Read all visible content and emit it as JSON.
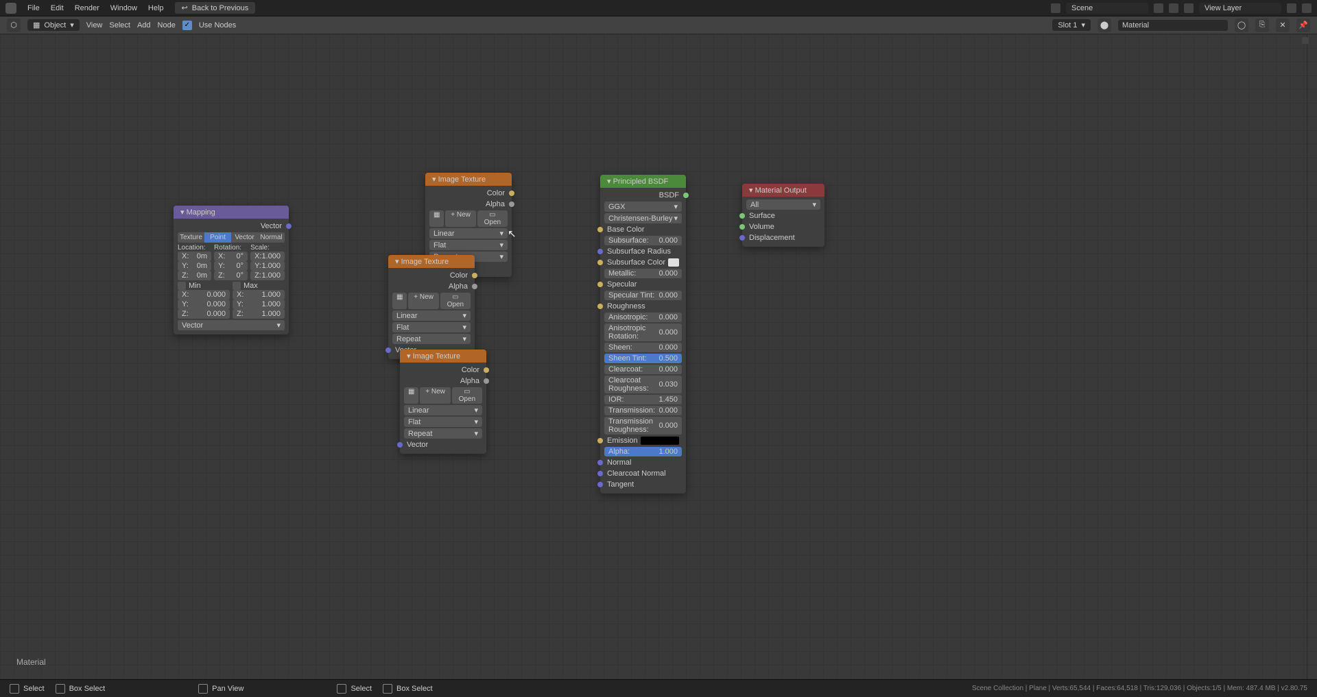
{
  "menu": {
    "file": "File",
    "edit": "Edit",
    "render": "Render",
    "window": "Window",
    "help": "Help",
    "back": "Back to Previous"
  },
  "top_right": {
    "scene": "Scene",
    "view_layer": "View Layer"
  },
  "header": {
    "mode": "Object",
    "view": "View",
    "select": "Select",
    "add": "Add",
    "node": "Node",
    "use_nodes": "Use Nodes",
    "slot": "Slot 1",
    "material": "Material"
  },
  "mat_label": "Material",
  "mapping": {
    "title": "Mapping",
    "out": "Vector",
    "tabs": [
      "Texture",
      "Point",
      "Vector",
      "Normal"
    ],
    "lbl_loc": "Location:",
    "lbl_rot": "Rotation:",
    "lbl_scale": "Scale:",
    "loc": [
      "0m",
      "0m",
      "0m"
    ],
    "rot": [
      "0°",
      "0°",
      "0°"
    ],
    "scale": [
      "1.000",
      "1.000",
      "1.000"
    ],
    "axes": [
      "X:",
      "Y:",
      "Z:"
    ],
    "min": "Min",
    "max": "Max",
    "minv": [
      "0.000",
      "0.000",
      "0.000"
    ],
    "maxv": [
      "1.000",
      "1.000",
      "1.000"
    ],
    "vec_in": "Vector"
  },
  "imgtex": {
    "title": "Image Texture",
    "color": "Color",
    "alpha": "Alpha",
    "new": "New",
    "open": "Open",
    "interp": "Linear",
    "proj": "Flat",
    "ext": "Repeat",
    "vec": "Vector"
  },
  "bsdf": {
    "title": "Principled BSDF",
    "out": "BSDF",
    "dist": "GGX",
    "sss_method": "Christensen-Burley",
    "inputs": [
      {
        "n": "Base Color",
        "t": "sock"
      },
      {
        "n": "Subsurface:",
        "v": "0.000",
        "t": "num"
      },
      {
        "n": "Subsurface Radius",
        "t": "sock"
      },
      {
        "n": "Subsurface Color",
        "t": "color",
        "c": "#e0e0e0"
      },
      {
        "n": "Metallic:",
        "v": "0.000",
        "t": "num"
      },
      {
        "n": "Specular",
        "t": "sock"
      },
      {
        "n": "Specular Tint:",
        "v": "0.000",
        "t": "num"
      },
      {
        "n": "Roughness",
        "t": "sock"
      },
      {
        "n": "Anisotropic:",
        "v": "0.000",
        "t": "num"
      },
      {
        "n": "Anisotropic Rotation:",
        "v": "0.000",
        "t": "num"
      },
      {
        "n": "Sheen:",
        "v": "0.000",
        "t": "num"
      },
      {
        "n": "Sheen Tint:",
        "v": "0.500",
        "t": "num",
        "hl": true
      },
      {
        "n": "Clearcoat:",
        "v": "0.000",
        "t": "num"
      },
      {
        "n": "Clearcoat Roughness:",
        "v": "0.030",
        "t": "num"
      },
      {
        "n": "IOR:",
        "v": "1.450",
        "t": "num"
      },
      {
        "n": "Transmission:",
        "v": "0.000",
        "t": "num"
      },
      {
        "n": "Transmission Roughness:",
        "v": "0.000",
        "t": "num"
      },
      {
        "n": "Emission",
        "t": "color",
        "c": "#000"
      },
      {
        "n": "Alpha:",
        "v": "1.000",
        "t": "num",
        "hl": true
      },
      {
        "n": "Normal",
        "t": "sock"
      },
      {
        "n": "Clearcoat Normal",
        "t": "sock"
      },
      {
        "n": "Tangent",
        "t": "sock"
      }
    ]
  },
  "output": {
    "title": "Material Output",
    "target": "All",
    "surface": "Surface",
    "volume": "Volume",
    "disp": "Displacement"
  },
  "status": {
    "select": "Select",
    "box": "Box Select",
    "pan": "Pan View",
    "info": "Scene Collection | Plane | Verts:65,544 | Faces:64,518 | Tris:129,036 | Objects:1/5 | Mem: 487.4 MB | v2.80.75"
  }
}
